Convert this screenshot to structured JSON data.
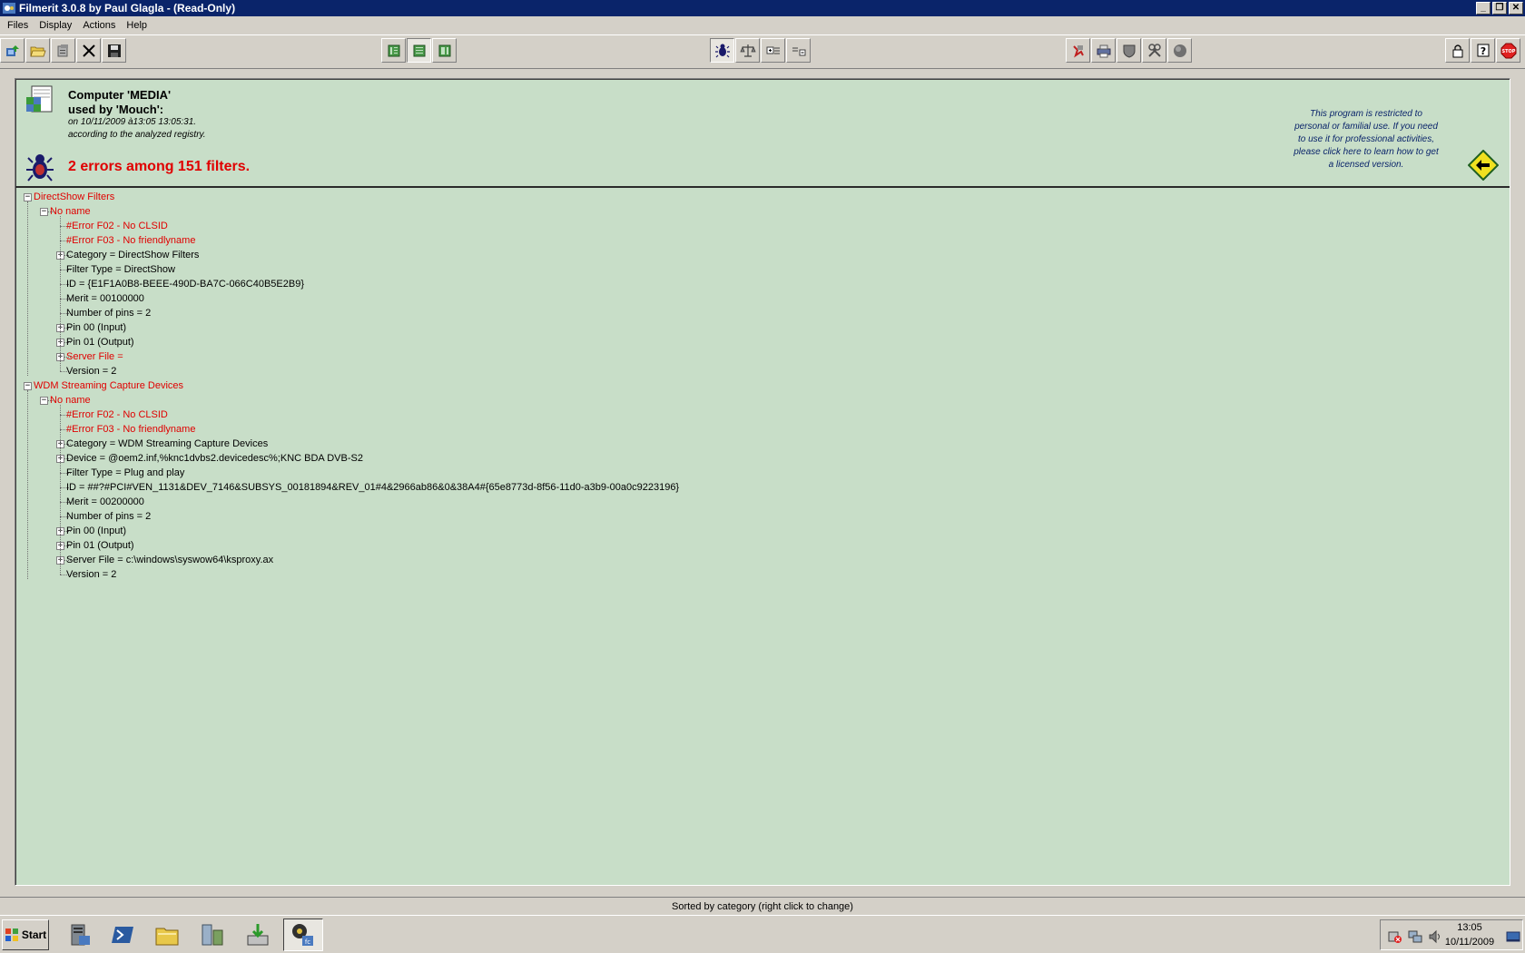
{
  "window": {
    "title": "Filmerit 3.0.8 by Paul Glagla - (Read-Only)",
    "minimize": "_",
    "maximize": "❐",
    "close": "✕"
  },
  "menu": {
    "items": [
      "Files",
      "Display",
      "Actions",
      "Help"
    ]
  },
  "toolbar": {
    "icons": [
      "scan-icon",
      "open-folder-icon",
      "copy-icon",
      "delete-icon",
      "save-icon",
      "view-list-icon",
      "view-detail-icon",
      "view-tree-icon",
      "bug-icon",
      "compare-icon",
      "expand-icon",
      "collapse-icon",
      "remove-icon",
      "printer-icon",
      "shield-icon",
      "tools-icon",
      "circle-icon",
      "lock-icon",
      "help-icon",
      "stop-icon"
    ],
    "stop_label": "STOP"
  },
  "header": {
    "line1": "Computer 'MEDIA'",
    "line2": "used by 'Mouch':",
    "line3": "on 10/11/2009 à13:05 13:05:31.",
    "line4": "according to the analyzed registry.",
    "errors": "2 errors among 151 filters.",
    "license_lines": [
      "This program is restricted to",
      "personal or familial use.  If you need",
      "to use it for professional activities,",
      "please click here to learn how to get",
      "a licensed version."
    ]
  },
  "tree": {
    "nodes": [
      {
        "level": 0,
        "text": "DirectShow Filters",
        "red": true,
        "expander": "−"
      },
      {
        "level": 1,
        "text": "No name",
        "red": true,
        "expander": "−"
      },
      {
        "level": 2,
        "text": "#Error F02 - No CLSID",
        "red": true,
        "expander": ""
      },
      {
        "level": 2,
        "text": "#Error F03 - No friendlyname",
        "red": true,
        "expander": ""
      },
      {
        "level": 2,
        "text": "Category = DirectShow Filters",
        "red": false,
        "expander": "+"
      },
      {
        "level": 2,
        "text": "Filter Type = DirectShow",
        "red": false,
        "expander": ""
      },
      {
        "level": 2,
        "text": "ID = {E1F1A0B8-BEEE-490D-BA7C-066C40B5E2B9}",
        "red": false,
        "expander": ""
      },
      {
        "level": 2,
        "text": "Merit = 00100000",
        "red": false,
        "expander": ""
      },
      {
        "level": 2,
        "text": "Number of pins = 2",
        "red": false,
        "expander": ""
      },
      {
        "level": 2,
        "text": "Pin 00 (Input)",
        "red": false,
        "expander": "+"
      },
      {
        "level": 2,
        "text": "Pin 01 (Output)",
        "red": false,
        "expander": "+"
      },
      {
        "level": 2,
        "text": "Server File =",
        "red": true,
        "expander": "+"
      },
      {
        "level": 2,
        "text": "Version = 2",
        "red": false,
        "expander": ""
      },
      {
        "level": 0,
        "text": "WDM Streaming Capture Devices",
        "red": true,
        "expander": "−"
      },
      {
        "level": 1,
        "text": "No name",
        "red": true,
        "expander": "−"
      },
      {
        "level": 2,
        "text": "#Error F02 - No CLSID",
        "red": true,
        "expander": ""
      },
      {
        "level": 2,
        "text": "#Error F03 - No friendlyname",
        "red": true,
        "expander": ""
      },
      {
        "level": 2,
        "text": "Category = WDM Streaming Capture Devices",
        "red": false,
        "expander": "+"
      },
      {
        "level": 2,
        "text": "Device = @oem2.inf,%knc1dvbs2.devicedesc%;KNC BDA DVB-S2",
        "red": false,
        "expander": "+"
      },
      {
        "level": 2,
        "text": "Filter Type = Plug and play",
        "red": false,
        "expander": ""
      },
      {
        "level": 2,
        "text": "ID = ##?#PCI#VEN_1131&DEV_7146&SUBSYS_00181894&REV_01#4&2966ab86&0&38A4#{65e8773d-8f56-11d0-a3b9-00a0c9223196}",
        "red": false,
        "expander": ""
      },
      {
        "level": 2,
        "text": "Merit = 00200000",
        "red": false,
        "expander": ""
      },
      {
        "level": 2,
        "text": "Number of pins = 2",
        "red": false,
        "expander": ""
      },
      {
        "level": 2,
        "text": "Pin 00 (Input)",
        "red": false,
        "expander": "+"
      },
      {
        "level": 2,
        "text": "Pin 01 (Output)",
        "red": false,
        "expander": "+"
      },
      {
        "level": 2,
        "text": "Server File = c:\\windows\\syswow64\\ksproxy.ax",
        "red": false,
        "expander": "+"
      },
      {
        "level": 2,
        "text": "Version = 2",
        "red": false,
        "expander": ""
      }
    ]
  },
  "status": {
    "text": "Sorted by category (right click to change)"
  },
  "taskbar": {
    "start_label": "Start",
    "tasks": [
      "server-manager-icon",
      "powershell-icon",
      "explorer-icon",
      "network-icon",
      "install-icon",
      "filmerit-icon"
    ],
    "tray_icons": [
      "error-tray-icon",
      "network-tray-icon",
      "volume-tray-icon"
    ],
    "time": "13:05",
    "date": "10/11/2009"
  },
  "colors": {
    "titlebar": "#0a246a",
    "panel": "#c8dec8",
    "error_red": "#e00000",
    "chrome": "#d4d0c8"
  }
}
